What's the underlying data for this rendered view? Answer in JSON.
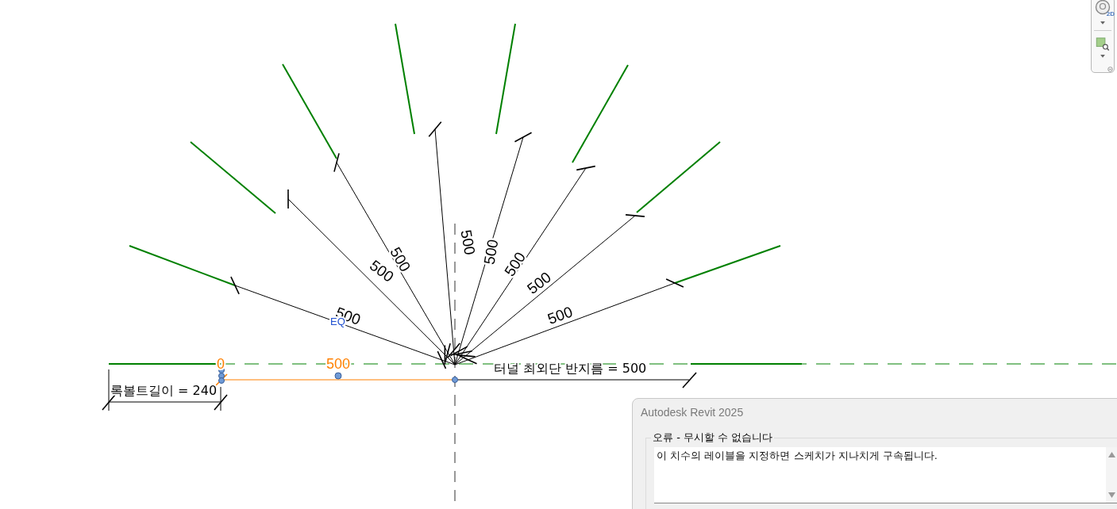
{
  "canvas": {
    "radial_dimensions": [
      {
        "label": "500"
      },
      {
        "label": "500"
      },
      {
        "label": "500"
      },
      {
        "label": "500"
      },
      {
        "label": "500"
      },
      {
        "label": "500"
      },
      {
        "label": "500"
      },
      {
        "label": "500"
      }
    ],
    "eq_label": "EQ",
    "bottom_dimension": {
      "label": "500",
      "end_label": "0",
      "selected": true
    },
    "rockbolt_label": "록볼트길이 = 240",
    "radius_label": "터널 최외단 반지름 = 500"
  },
  "navigation_bar": {
    "badge": "2D"
  },
  "dialog": {
    "title": "Autodesk Revit 2025",
    "group_label": "오류 - 무시할 수 없습니다",
    "message": "이 치수의 레이블을 지정하면 스케치가 지나치게 구속됩니다."
  }
}
